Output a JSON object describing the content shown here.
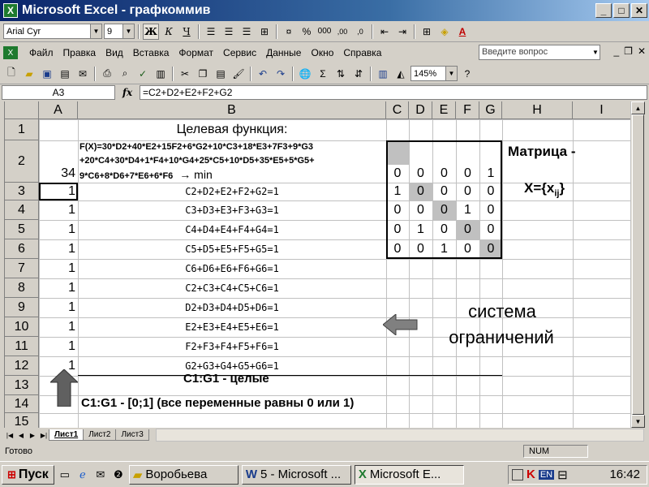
{
  "window": {
    "title": "Microsoft Excel - графкоммив",
    "app_icon": "X"
  },
  "format_toolbar": {
    "font": "Arial Cyr",
    "size": "9",
    "bold": "Ж",
    "italic": "К",
    "underline": "Ч",
    "percent": "%",
    "thousands": "000",
    "inc_decimal": ",00",
    "dec_decimal": ",0"
  },
  "menu": {
    "items": [
      "Файл",
      "Правка",
      "Вид",
      "Вставка",
      "Формат",
      "Сервис",
      "Данные",
      "Окно",
      "Справка"
    ],
    "ask_placeholder": "Введите вопрос"
  },
  "std_toolbar": {
    "zoom": "145%"
  },
  "formula_bar": {
    "name_box": "A3",
    "fx": "fx",
    "formula": "=C2+D2+E2+F2+G2"
  },
  "columns": [
    "A",
    "B",
    "C",
    "D",
    "E",
    "F",
    "G",
    "H",
    "I"
  ],
  "rows": [
    "1",
    "2",
    "3",
    "4",
    "5",
    "6",
    "7",
    "8",
    "9",
    "10",
    "11",
    "12",
    "13",
    "14",
    "15"
  ],
  "cells": {
    "B1": "Целевая функция:",
    "B2_line1": "F(X)=30*D2+40*E2+15F2+6*G2+10*C3+18*E3+7F3+9*G3",
    "B2_line2": "+20*C4+30*D4+1*F4+10*G4+25*C5+10*D5+35*E5+5*G5+",
    "B2_line3": "9*C6+8*D6+7*E6+6*F6",
    "B2_suffix": "→ min",
    "A2": "34",
    "A_values": [
      "1",
      "1",
      "1",
      "1",
      "1",
      "1",
      "1",
      "1",
      "1",
      "1"
    ],
    "B_constraints": [
      "C2+D2+E2+F2+G2=1",
      "C3+D3+E3+F3+G3=1",
      "C4+D4+E4+F4+G4=1",
      "C5+D5+E5+F5+G5=1",
      "C6+D6+E6+F6+G6=1",
      "C2+C3+C4+C5+C6=1",
      "D2+D3+D4+D5+D6=1",
      "E2+E3+E4+E5+E6=1",
      "F2+F3+F4+F5+F6=1",
      "G2+G3+G4+G5+G6=1"
    ],
    "B13": "C1:G1 - целые",
    "B14": "C1:G1 - [0;1] (все переменные равны 0 или 1)",
    "matrix": [
      [
        "0",
        "0",
        "0",
        "0",
        "1"
      ],
      [
        "1",
        "0",
        "0",
        "0",
        "0"
      ],
      [
        "0",
        "0",
        "0",
        "1",
        "0"
      ],
      [
        "0",
        "1",
        "0",
        "0",
        "0"
      ],
      [
        "0",
        "0",
        "1",
        "0",
        "0"
      ]
    ],
    "matrix_title": "Матрица -",
    "matrix_formula": "X={x",
    "matrix_sub": "ij",
    "matrix_close": "}",
    "system_line1": "система",
    "system_line2": "ограничений"
  },
  "sheet_tabs": [
    "Лист1",
    "Лист2",
    "Лист3"
  ],
  "status": {
    "text": "Готово",
    "num": "NUM"
  },
  "taskbar": {
    "start": "Пуск",
    "tasks": [
      "Воробьева",
      "5 - Microsoft ...",
      "Microsoft E..."
    ],
    "lang": "EN",
    "clock": "16:42"
  }
}
